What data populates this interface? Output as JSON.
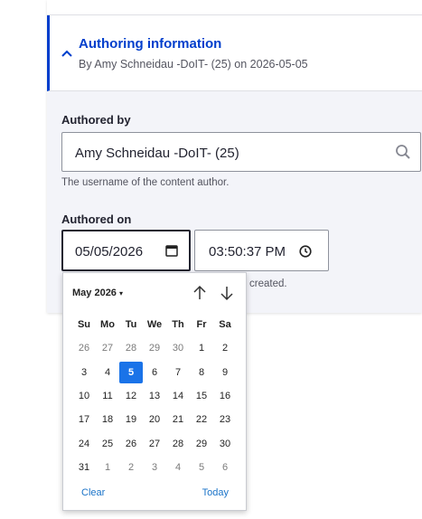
{
  "summary": {
    "title": "Authoring information",
    "subtitle": "By Amy Schneidau -DoIT- (25) on 2026-05-05"
  },
  "authored_by": {
    "label": "Authored by",
    "value": "Amy Schneidau -DoIT- (25)",
    "description": "The username of the content author."
  },
  "authored_on": {
    "label": "Authored on",
    "date_value": "05/05/2026",
    "time_value": "03:50:37 PM",
    "description_visible": "created."
  },
  "datepicker": {
    "month_label": "May 2026",
    "caret": "▾",
    "weekdays": [
      "Su",
      "Mo",
      "Tu",
      "We",
      "Th",
      "Fr",
      "Sa"
    ],
    "weeks": [
      [
        "26",
        "27",
        "28",
        "29",
        "30",
        "1",
        "2"
      ],
      [
        "3",
        "4",
        "5",
        "6",
        "7",
        "8",
        "9"
      ],
      [
        "10",
        "11",
        "12",
        "13",
        "14",
        "15",
        "16"
      ],
      [
        "17",
        "18",
        "19",
        "20",
        "21",
        "22",
        "23"
      ],
      [
        "24",
        "25",
        "26",
        "27",
        "28",
        "29",
        "30"
      ],
      [
        "31",
        "1",
        "2",
        "3",
        "4",
        "5",
        "6"
      ]
    ],
    "selected": "5",
    "clear_label": "Clear",
    "today_label": "Today"
  },
  "icons": {
    "expand": "chevron-up-icon",
    "search": "search-icon",
    "calendar": "calendar-icon",
    "clock": "clock-icon",
    "prev": "arrow-up-icon",
    "next": "arrow-down-icon"
  },
  "colors": {
    "accent": "#003ecc",
    "selected_day": "#1a73e8",
    "link": "#1a73c8"
  }
}
